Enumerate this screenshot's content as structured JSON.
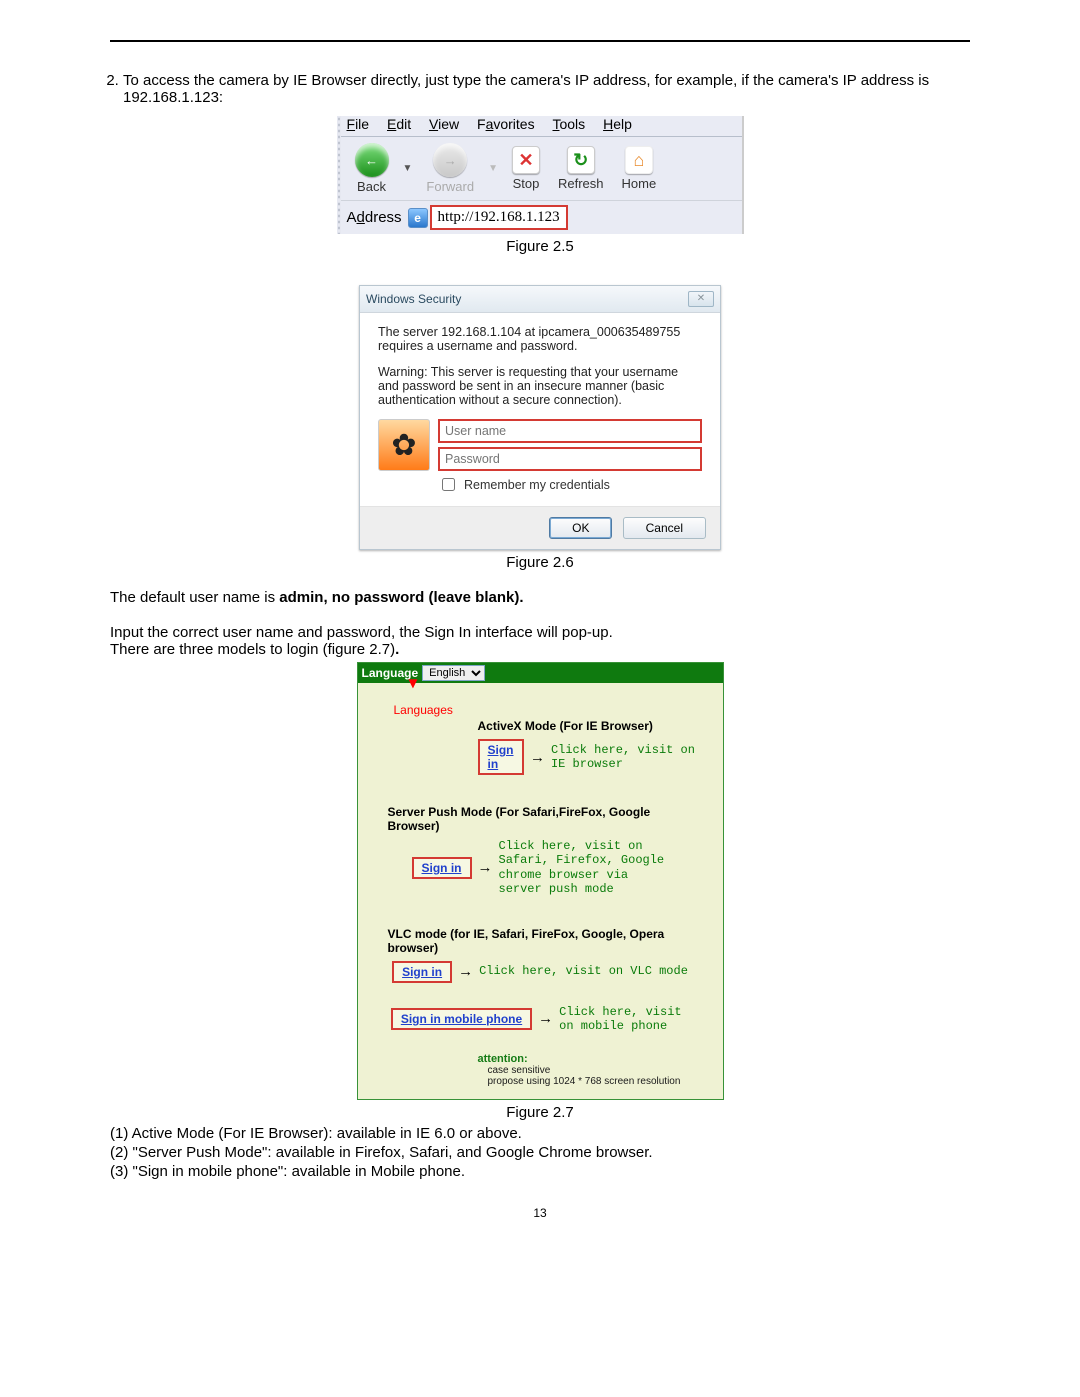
{
  "list_item": "To access the camera by IE Browser directly, just type the camera's IP address, for example, if the camera's IP address is 192.168.1.123:",
  "fig25_caption": "Figure 2.5",
  "fig26_caption": "Figure 2.6",
  "fig27_caption": "Figure 2.7",
  "browser": {
    "menu": {
      "file": "File",
      "edit": "Edit",
      "view": "View",
      "favorites": "Favorites",
      "tools": "Tools",
      "help": "Help"
    },
    "back": "Back",
    "forward": "Forward",
    "stop": "Stop",
    "refresh": "Refresh",
    "home": "Home",
    "address_label": "Address",
    "url": "http://192.168.1.123"
  },
  "security": {
    "title": "Windows Security",
    "line1": "The server 192.168.1.104 at ipcamera_000635489755 requires a username and password.",
    "line2": "Warning: This server is requesting that your username and password be sent in an insecure manner (basic authentication without a secure connection).",
    "user_placeholder": "User name",
    "pass_placeholder": "Password",
    "remember": "Remember my credentials",
    "ok": "OK",
    "cancel": "Cancel"
  },
  "body": {
    "p1a": "The default user name is ",
    "p1b": "admin, no password (leave blank).",
    "p2": "Input the correct user name and password, the Sign In interface will pop-up.",
    "p3a": "There are three models to login (figure 2.7)",
    "p3b": "."
  },
  "fig27": {
    "language_label": "Language",
    "language_value": "English",
    "languages_caption": "Languages",
    "h1": "ActiveX Mode (For IE Browser)",
    "signin": "Sign in",
    "anno1": "Click here, visit on IE browser",
    "h2": "Server Push Mode (For Safari,FireFox, Google Browser)",
    "anno2": "Click here, visit on Safari, Firefox, Google chrome browser via server push mode",
    "h3": "VLC mode (for IE, Safari, FireFox, Google, Opera browser)",
    "anno3": "Click here, visit on VLC mode",
    "signin_mobile": "Sign in mobile phone",
    "anno4": "Click here, visit on mobile phone",
    "attention": "attention:",
    "att1": "case sensitive",
    "att2": "propose using 1024 * 768 screen resolution"
  },
  "closing": {
    "l1": "(1) Active Mode (For IE Browser): available in IE 6.0 or above.",
    "l2": "(2) \"Server Push Mode\": available in Firefox, Safari, and Google Chrome browser.",
    "l3": "(3) \"Sign in mobile phone\": available in Mobile phone."
  },
  "page_number": "13"
}
